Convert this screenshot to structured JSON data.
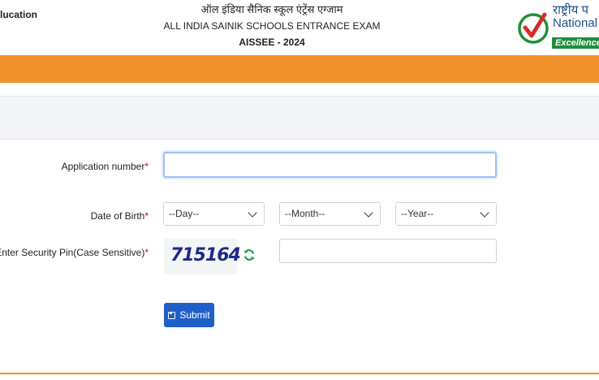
{
  "header": {
    "left_text": "lucation",
    "title_hindi": "ऑल इंडिया सैनिक स्कूल एंट्रेंस एग्जाम",
    "title_english": "ALL INDIA SAINIK SCHOOLS ENTRANCE EXAM",
    "subtitle": "AISSEE - 2024",
    "logo": {
      "hindi_text": "राष्ट्रीय प",
      "english_text": "National T",
      "tagline": "Excellence",
      "icon": "checkmark-logo-icon"
    }
  },
  "form": {
    "application_number": {
      "label": "Application number",
      "required_mark": "*",
      "value": ""
    },
    "date_of_birth": {
      "label": "Date of Birth",
      "required_mark": "*",
      "day": "--Day--",
      "month": "--Month--",
      "year": "--Year--"
    },
    "security_pin": {
      "label": "Enter Security Pin(Case Sensitive)",
      "required_mark": "*",
      "captcha_text": "715164",
      "refresh_icon": "refresh-icon",
      "value": ""
    },
    "submit_label": "Submit",
    "submit_icon": "save-icon"
  },
  "colors": {
    "orange": "#f0922b",
    "button": "#1e5fc8",
    "refresh": "#2a9a3a",
    "logo_green": "#1f8f3a",
    "logo_blue": "#1b4d8c"
  }
}
